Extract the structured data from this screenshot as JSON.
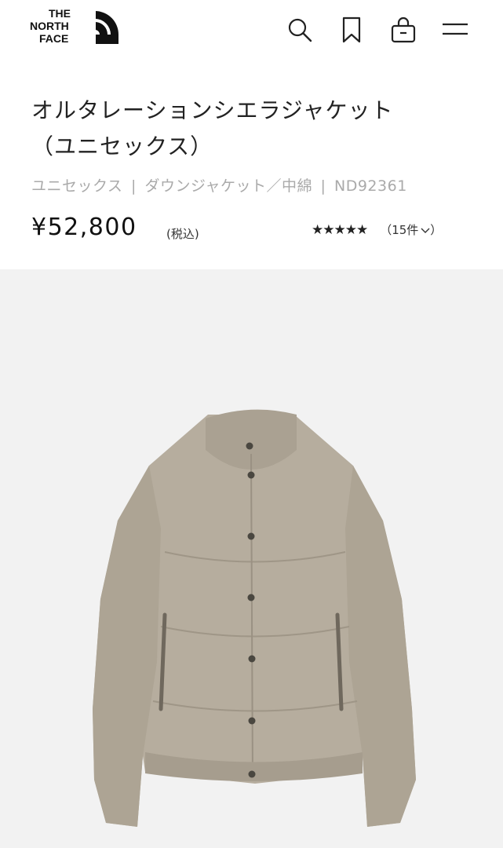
{
  "header": {
    "logo_lines": [
      "THE",
      "NORTH",
      "FACE"
    ],
    "icons": [
      "search-icon",
      "bookmark-icon",
      "cart-icon",
      "menu-icon"
    ]
  },
  "product": {
    "title_line1": "オルタレーションシエラジャケット",
    "title_line2": "（ユニセックス）",
    "breadcrumb": {
      "category": "ユニセックス",
      "type": "ダウンジャケット／中綿",
      "code": "ND92361",
      "separator": "|"
    },
    "price": "¥52,800",
    "tax_label": "(税込)",
    "rating": {
      "stars": 5,
      "stars_text": "★★★★★",
      "reviews_label": "（15件"
    }
  },
  "image": {
    "background": "#f2f2f2",
    "jacket_color": "#b7ae9f"
  }
}
